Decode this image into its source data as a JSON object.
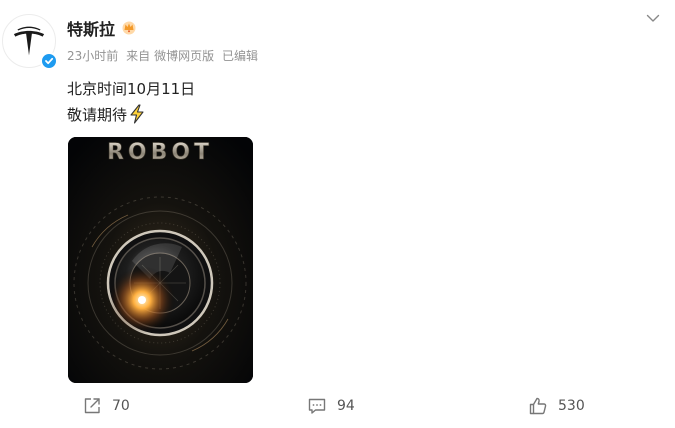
{
  "post": {
    "author": {
      "name": "特斯拉"
    },
    "meta": {
      "time": "23小时前",
      "source_prefix": "来自",
      "source": "微博网页版",
      "edited": "已编辑"
    },
    "text_line1": "北京时间10月11日",
    "text_line2": "敬请期待",
    "image": {
      "title_text": "ROBOT"
    }
  },
  "actions": {
    "share_count": "70",
    "comment_count": "94",
    "like_count": "530"
  },
  "colors": {
    "verified": "#1e9bf0",
    "meta_text": "#939393",
    "link": "#eb7350"
  }
}
